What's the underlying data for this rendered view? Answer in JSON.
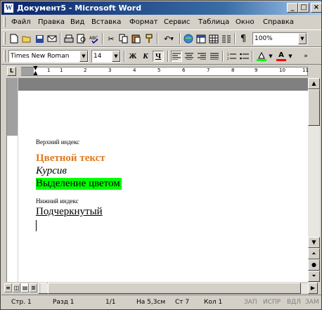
{
  "window": {
    "app_icon": "W",
    "title": "Документ5 - Microsoft Word",
    "controls": {
      "minimize": "_",
      "maximize": "□",
      "close": "×"
    }
  },
  "menu": [
    "Файл",
    "Правка",
    "Вид",
    "Вставка",
    "Формат",
    "Сервис",
    "Таблица",
    "Окно",
    "Справка"
  ],
  "toolbar_standard": {
    "zoom": "100%",
    "icons": [
      "new-document-icon",
      "open-folder-icon",
      "save-icon",
      "email-icon",
      "print-icon",
      "print-preview-icon",
      "spelling-icon",
      "cut-icon",
      "copy-icon",
      "paste-icon",
      "format-painter-icon",
      "undo-icon",
      "hyperlink-icon",
      "tables-borders-icon",
      "insert-table-icon",
      "columns-icon",
      "show-formatting-icon"
    ]
  },
  "toolbar_formatting": {
    "font": "Times New Roman",
    "size": "14",
    "bold": "Ж",
    "italic": "К",
    "underline": "Ч",
    "highlight_color": "#00ff00",
    "font_color": "#ff0000"
  },
  "ruler": {
    "numbers": [
      "1",
      "1",
      "2",
      "3",
      "4",
      "5",
      "6",
      "7",
      "8",
      "9",
      "10",
      "11"
    ]
  },
  "document": {
    "lines": [
      {
        "text": "Верхний индекс",
        "style": "superscript"
      },
      {
        "text": "Цветной текст",
        "style": "colored",
        "color": "#e07a1f"
      },
      {
        "text": "Курсив",
        "style": "italic"
      },
      {
        "text": "Выделение цветом",
        "style": "highlight",
        "color": "#00ff00"
      },
      {
        "text": "Нижний индекс",
        "style": "subscript"
      },
      {
        "text": "Подчеркнутый",
        "style": "underline"
      }
    ]
  },
  "status": {
    "page": "Стр. 1",
    "section": "Разд 1",
    "pages": "1/1",
    "position": "На 5,3см",
    "line": "Ст 7",
    "column": "Кол 1",
    "rec": "ЗАП",
    "trk": "ИСПР",
    "ext": "ВДЛ",
    "ovr": "ЗАМ"
  }
}
